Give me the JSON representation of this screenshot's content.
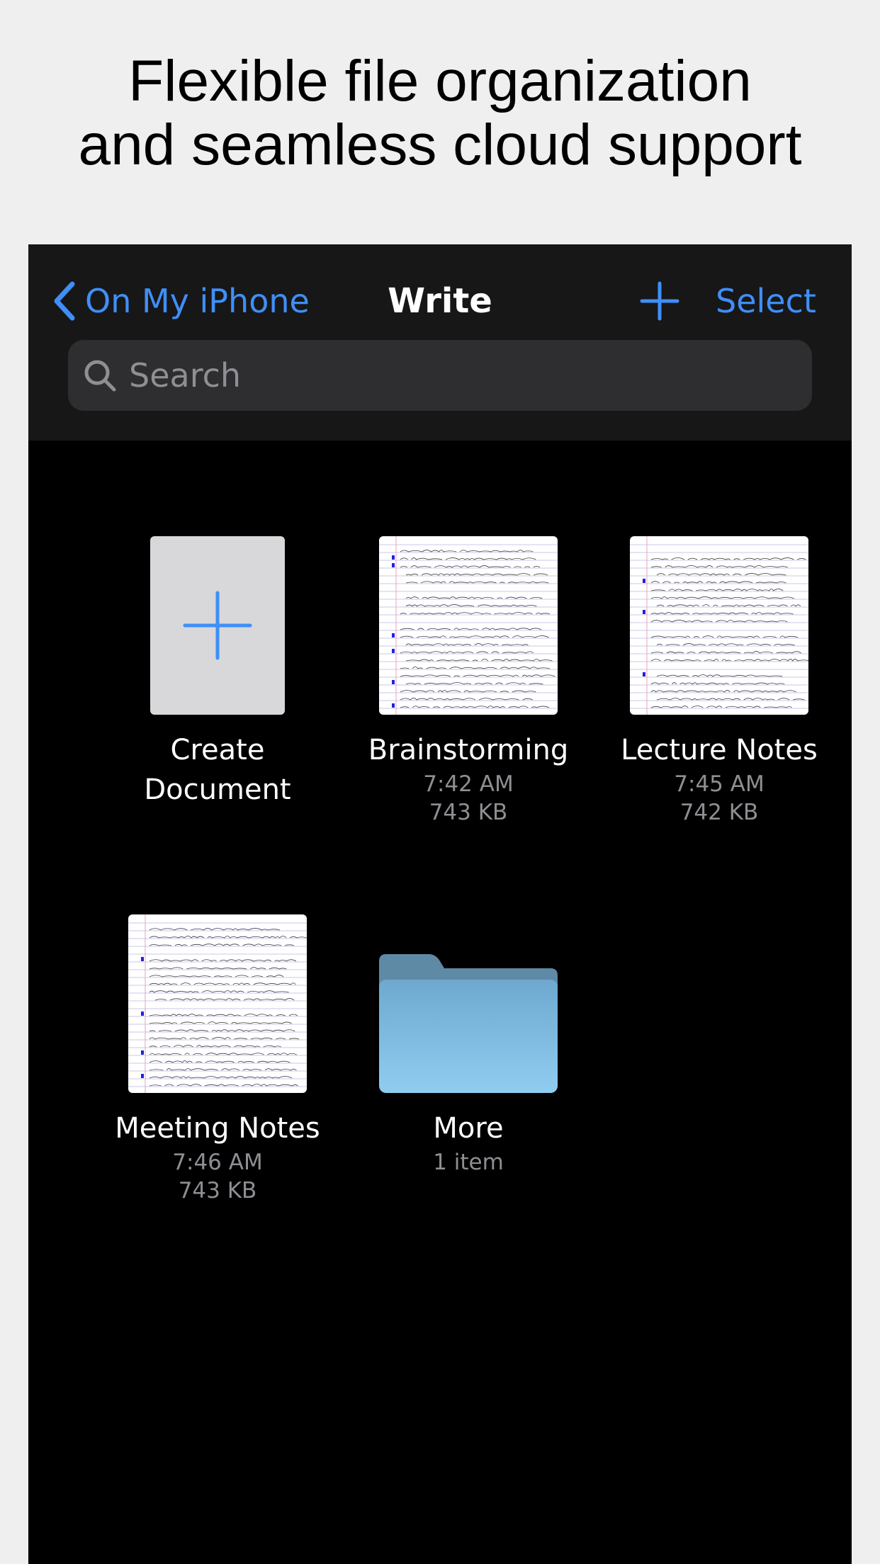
{
  "headline": {
    "line1": "Flexible file organization",
    "line2": "and seamless cloud support"
  },
  "navbar": {
    "back_label": "On My iPhone",
    "title": "Write",
    "select_label": "Select"
  },
  "search": {
    "placeholder": "Search"
  },
  "items": [
    {
      "name": "Create\nDocument",
      "type": "create"
    },
    {
      "name": "Brainstorming",
      "time": "7:42 AM",
      "size": "743 KB",
      "type": "document"
    },
    {
      "name": "Lecture Notes",
      "time": "7:45 AM",
      "size": "742 KB",
      "type": "document"
    },
    {
      "name": "Meeting Notes",
      "time": "7:46 AM",
      "size": "743 KB",
      "type": "document"
    },
    {
      "name": "More",
      "count": "1 item",
      "type": "folder"
    }
  ],
  "colors": {
    "accent": "#3f8ff7",
    "navbar_bg": "#171718",
    "content_bg": "#000000",
    "folder_top": "#6d9fc0",
    "folder_bottom": "#8fcdf0"
  }
}
